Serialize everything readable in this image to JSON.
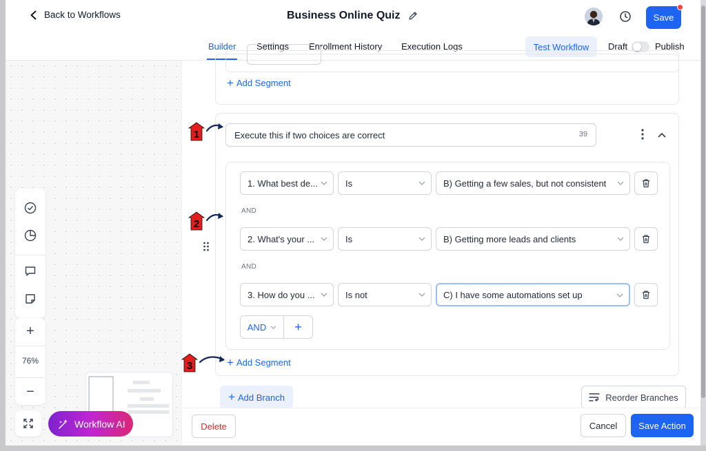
{
  "header": {
    "back_label": "Back to Workflows",
    "title": "Business Online Quiz",
    "save_label": "Save"
  },
  "tabs": [
    {
      "label": "Builder",
      "active": true
    },
    {
      "label": "Settings",
      "active": false
    },
    {
      "label": "Enrollment History",
      "active": false
    },
    {
      "label": "Execution Logs",
      "active": false
    }
  ],
  "toolbar_right": {
    "test_label": "Test Workflow",
    "draft_label": "Draft",
    "publish_label": "Publish"
  },
  "canvas": {
    "zoom_level": "76%",
    "ai_label": "Workflow AI"
  },
  "panel": {
    "add_segment_label": "Add Segment",
    "branch": {
      "name": "Execute this if two choices are correct",
      "char_count": "39",
      "conditions": [
        {
          "field": "1. What best de...",
          "operator": "Is",
          "value": "B) Getting a few sales, but not consistent"
        },
        {
          "field": "2. What's your ...",
          "operator": "Is",
          "value": "B) Getting more leads and clients"
        },
        {
          "field": "3. How do you ...",
          "operator": "Is not",
          "value": "C) I have some automations set up"
        }
      ],
      "joiner": "AND",
      "and_button_label": "AND"
    },
    "add_branch_label": "Add Branch",
    "reorder_label": "Reorder Branches",
    "delete_label": "Delete",
    "cancel_label": "Cancel",
    "save_action_label": "Save Action"
  },
  "annotations": [
    "1",
    "2",
    "3"
  ],
  "colors": {
    "accent": "#1d64f2",
    "danger": "#dc2626",
    "annotation_red": "#e11d1d",
    "arrow_navy": "#14285a"
  }
}
